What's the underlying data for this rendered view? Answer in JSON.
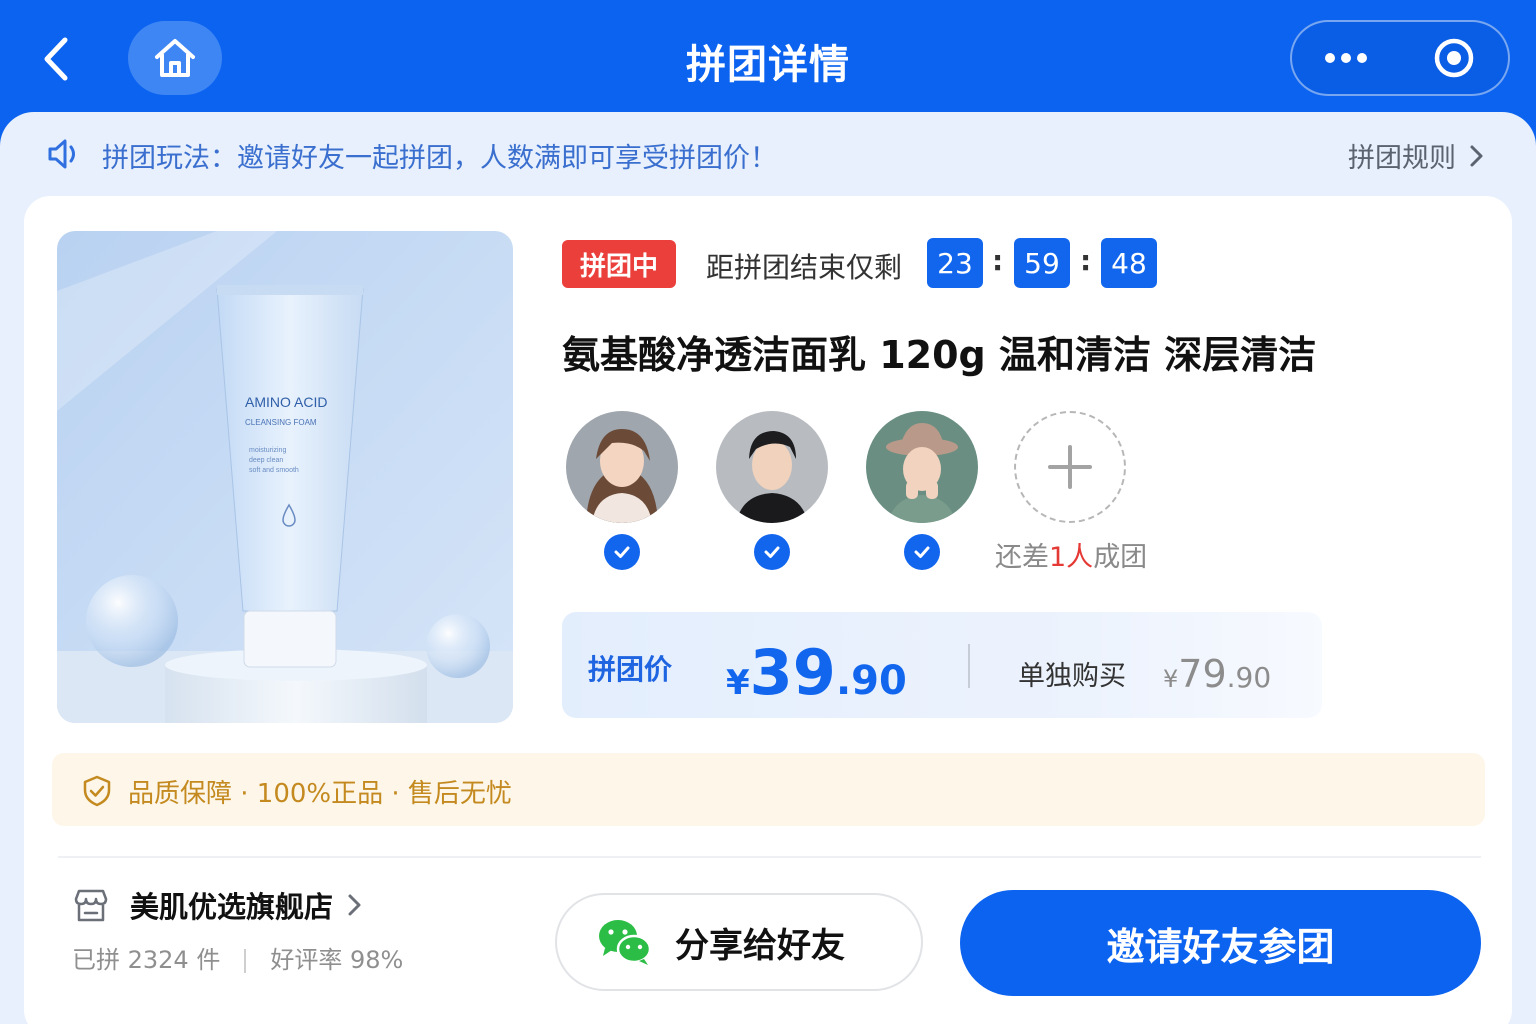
{
  "header": {
    "title": "拼团详情"
  },
  "notice": {
    "text": "拼团玩法：邀请好友一起拼团，人数满即可享受拼团价！",
    "rule_label": "拼团规则"
  },
  "product": {
    "status_badge": "拼团中",
    "countdown_label": "距拼团结束仅剩",
    "countdown": {
      "hours": "23",
      "minutes": "59",
      "seconds": "48",
      "sep": ":"
    },
    "title": "氨基酸净透洁面乳 120g 温和清洁 深层清洁",
    "image_text": {
      "brand": "AMINO ACID",
      "sub": "CLEANSING FOAM",
      "desc1": "moisturizing",
      "desc2": "deep clean",
      "desc3": "soft and smooth"
    }
  },
  "group": {
    "members": [
      {
        "joined": true
      },
      {
        "joined": true
      },
      {
        "joined": true
      }
    ],
    "need_prefix": "还差",
    "need_count": "1人",
    "need_suffix": "成团"
  },
  "price": {
    "group_label": "拼团价",
    "group_currency": "¥",
    "group_int": "39",
    "group_dec": ".90",
    "single_label": "单独购买",
    "single_currency": "¥",
    "single_int": "79",
    "single_dec": ".90"
  },
  "quality": {
    "text": "品质保障 · 100%正品 · 售后无忧"
  },
  "store": {
    "name": "美肌优选旗舰店",
    "sold": "已拼 2324 件",
    "rating": "好评率 98%"
  },
  "actions": {
    "share_label": "分享给好友",
    "invite_label": "邀请好友参团"
  },
  "colors": {
    "primary": "#0b63f0",
    "badge_red": "#ea3f3b",
    "quality_text": "#c48a1f",
    "wechat_green": "#2bbd45"
  }
}
